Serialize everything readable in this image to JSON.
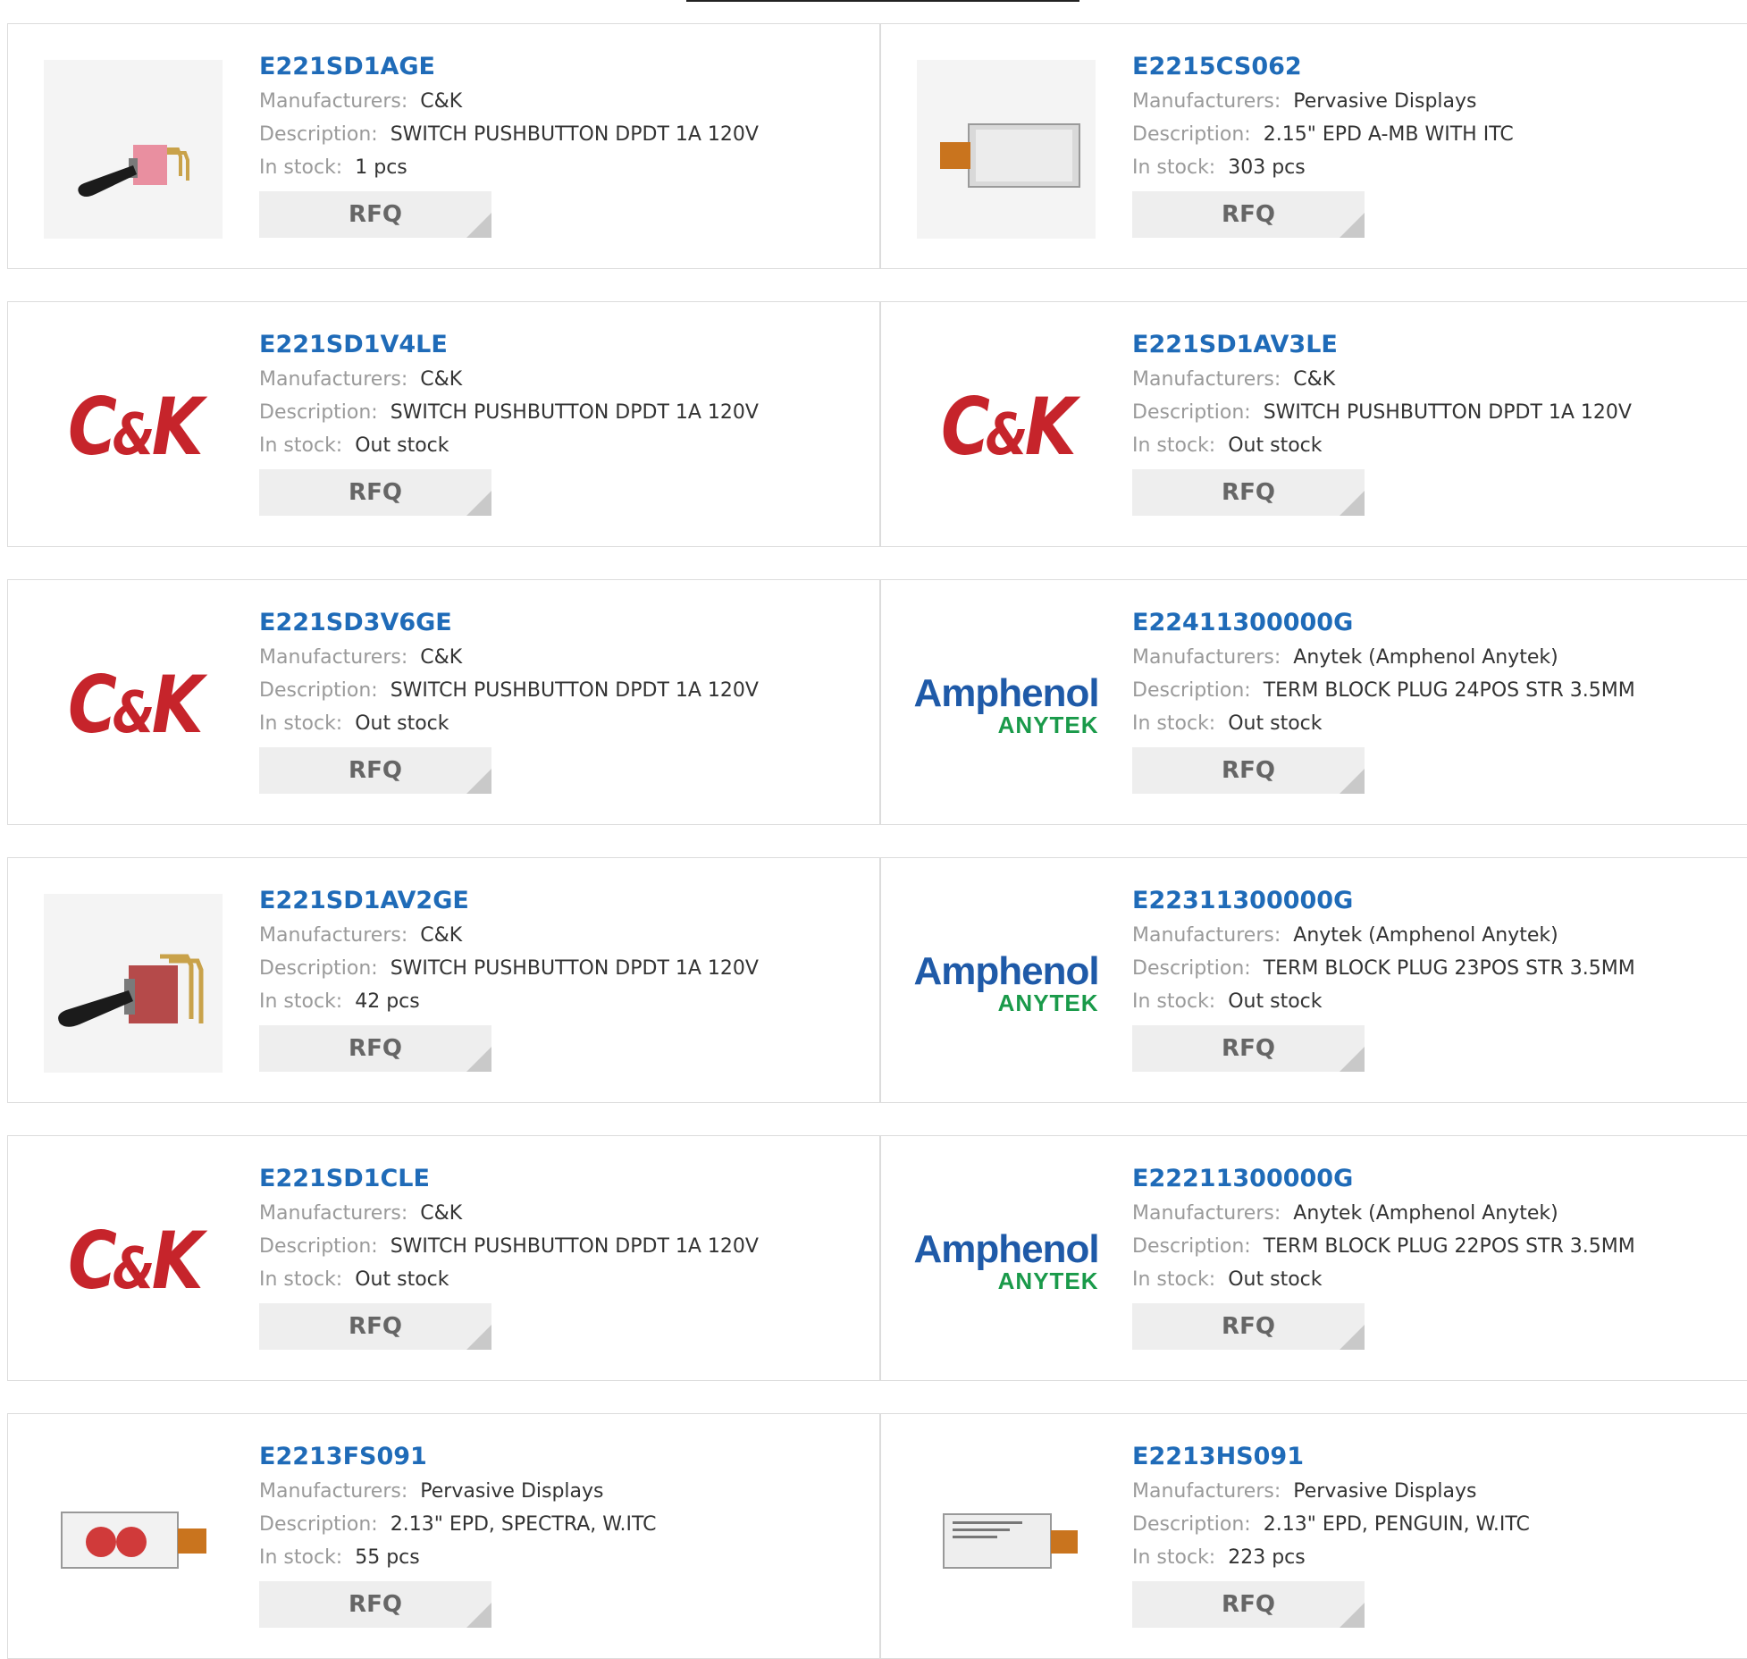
{
  "labels": {
    "manufacturer": "Manufacturers:",
    "description": "Description:",
    "stock": "In stock:",
    "rfq": "RFQ"
  },
  "logos": {
    "ck": "C&K",
    "amphenol_top": "Amphenol",
    "amphenol_bottom": "ANYTEK"
  },
  "products": [
    {
      "part": "E221SD1AGE",
      "manufacturer": "C&K",
      "description": "SWITCH PUSHBUTTON DPDT 1A 120V",
      "stock": "1 pcs",
      "image": "toggle-switch-pink"
    },
    {
      "part": "E2215CS062",
      "manufacturer": "Pervasive Displays",
      "description": "2.15\" EPD A-MB WITH ITC",
      "stock": "303 pcs",
      "image": "epd-panel"
    },
    {
      "part": "E221SD1V4LE",
      "manufacturer": "C&K",
      "description": "SWITCH PUSHBUTTON DPDT 1A 120V",
      "stock": "Out stock",
      "image": "ck-logo"
    },
    {
      "part": "E221SD1AV3LE",
      "manufacturer": "C&K",
      "description": "SWITCH PUSHBUTTON DPDT 1A 120V",
      "stock": "Out stock",
      "image": "ck-logo"
    },
    {
      "part": "E221SD3V6GE",
      "manufacturer": "C&K",
      "description": "SWITCH PUSHBUTTON DPDT 1A 120V",
      "stock": "Out stock",
      "image": "ck-logo"
    },
    {
      "part": "E22411300000G",
      "manufacturer": "Anytek (Amphenol Anytek)",
      "description": "TERM BLOCK PLUG 24POS STR 3.5MM",
      "stock": "Out stock",
      "image": "amphenol-logo"
    },
    {
      "part": "E221SD1AV2GE",
      "manufacturer": "C&K",
      "description": "SWITCH PUSHBUTTON DPDT 1A 120V",
      "stock": "42 pcs",
      "image": "toggle-switch-red"
    },
    {
      "part": "E22311300000G",
      "manufacturer": "Anytek (Amphenol Anytek)",
      "description": "TERM BLOCK PLUG 23POS STR 3.5MM",
      "stock": "Out stock",
      "image": "amphenol-logo"
    },
    {
      "part": "E221SD1CLE",
      "manufacturer": "C&K",
      "description": "SWITCH PUSHBUTTON DPDT 1A 120V",
      "stock": "Out stock",
      "image": "ck-logo"
    },
    {
      "part": "E22211300000G",
      "manufacturer": "Anytek (Amphenol Anytek)",
      "description": "TERM BLOCK PLUG 22POS STR 3.5MM",
      "stock": "Out stock",
      "image": "amphenol-logo"
    },
    {
      "part": "E2213FS091",
      "manufacturer": "Pervasive Displays",
      "description": "2.13\" EPD, SPECTRA, W.ITC",
      "stock": "55 pcs",
      "image": "epd-panel-spectra"
    },
    {
      "part": "E2213HS091",
      "manufacturer": "Pervasive Displays",
      "description": "2.13\" EPD, PENGUIN, W.ITC",
      "stock": "223 pcs",
      "image": "epd-panel-penguin"
    }
  ]
}
